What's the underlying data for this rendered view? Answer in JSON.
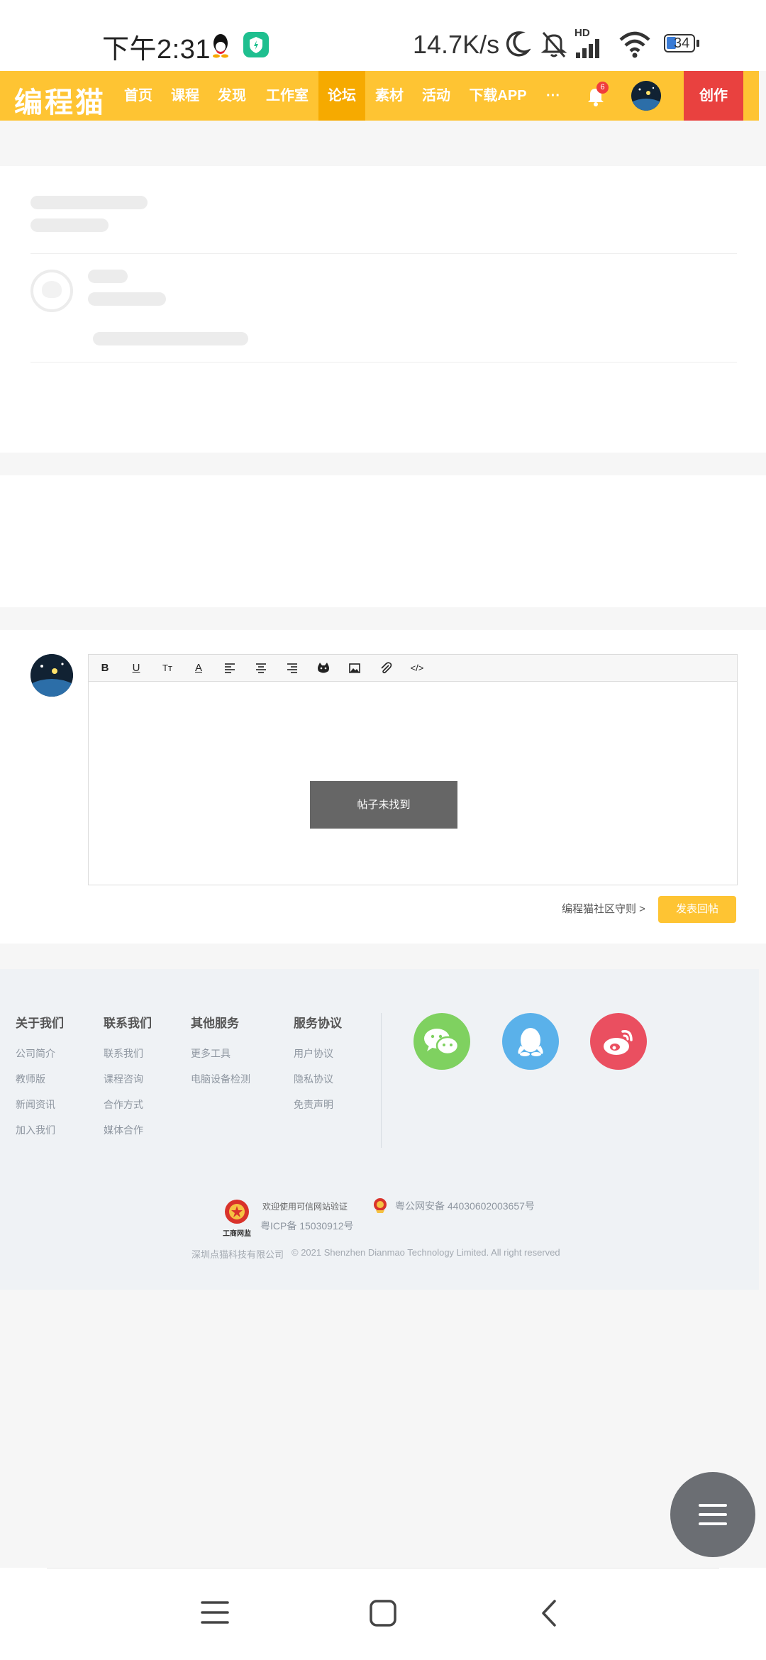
{
  "status_bar": {
    "time": "下午2:31",
    "net_speed": "14.7K/s",
    "hd_label": "HD",
    "battery": "34",
    "icons": [
      "qq-icon",
      "shield-app-icon",
      "moon-icon",
      "mute-bell-icon",
      "signal-icon",
      "wifi-icon",
      "battery-icon"
    ]
  },
  "nav": {
    "logo": "编程猫",
    "items": [
      {
        "label": "首页"
      },
      {
        "label": "课程"
      },
      {
        "label": "发现"
      },
      {
        "label": "工作室"
      },
      {
        "label": "论坛"
      },
      {
        "label": "素材"
      },
      {
        "label": "活动"
      },
      {
        "label": "下载APP"
      },
      {
        "label": "···"
      }
    ],
    "active_item": "论坛",
    "notification_count": "6",
    "create_label": "创作",
    "colors": {
      "bar": "#fec433",
      "active": "#f6aa00",
      "create": "#e9413f"
    }
  },
  "reply": {
    "toolbar": [
      {
        "name": "bold-icon",
        "glyph": "B"
      },
      {
        "name": "underline-icon",
        "glyph": "U"
      },
      {
        "name": "font-size-icon",
        "glyph": "Tт"
      },
      {
        "name": "font-color-icon",
        "glyph": "A"
      },
      {
        "name": "align-left-icon",
        "glyph": ""
      },
      {
        "name": "align-center-icon",
        "glyph": ""
      },
      {
        "name": "align-right-icon",
        "glyph": ""
      },
      {
        "name": "cat-emoji-icon",
        "glyph": ""
      },
      {
        "name": "image-icon",
        "glyph": ""
      },
      {
        "name": "attachment-icon",
        "glyph": ""
      },
      {
        "name": "code-icon",
        "glyph": "</>"
      }
    ],
    "toast": "帖子未找到",
    "rules_link": "编程猫社区守则 >",
    "submit_label": "发表回帖"
  },
  "footer": {
    "columns": [
      {
        "title": "关于我们",
        "links": [
          "公司简介",
          "教师版",
          "新闻资讯",
          "加入我们"
        ]
      },
      {
        "title": "联系我们",
        "links": [
          "联系我们",
          "课程咨询",
          "合作方式",
          "媒体合作"
        ]
      },
      {
        "title": "其他服务",
        "links": [
          "更多工具",
          "电脑设备检测"
        ]
      },
      {
        "title": "服务协议",
        "links": [
          "用户协议",
          "隐私协议",
          "免责声明"
        ]
      }
    ],
    "social": [
      {
        "name": "wechat-icon",
        "color": "#7fd160"
      },
      {
        "name": "qq-icon",
        "color": "#5ab1ea"
      },
      {
        "name": "weibo-icon",
        "color": "#ea4f60"
      }
    ],
    "trust_label": "欢迎使用可信网站验证",
    "badge_caption": "工商网监",
    "police_record": "粤公网安备 44030602003657号",
    "icp": "粤ICP备 15030912号",
    "company": "深圳点猫科技有限公司",
    "copyright": "© 2021 Shenzhen Dianmao Technology Limited. All right reserved"
  }
}
